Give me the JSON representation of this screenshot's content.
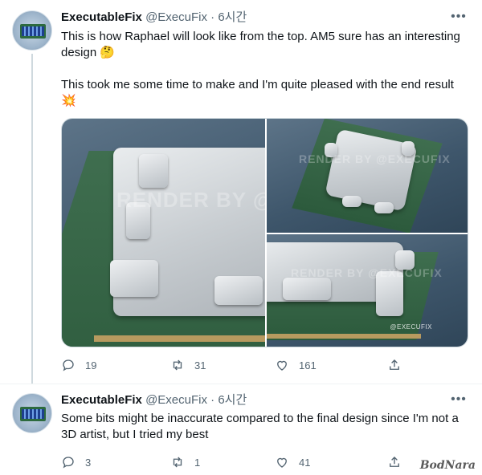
{
  "tweets": [
    {
      "author_name": "ExecutableFix",
      "author_handle": "@ExecuFix",
      "separator": "·",
      "time": "6시간",
      "text_paragraphs": [
        "This is how Raphael will look like from the top. AM5 sure has an interesting design 🤔",
        "This took me some time to make and I'm quite pleased with the end result 💥"
      ],
      "media": {
        "watermark_large": "RENDER BY @",
        "watermark_top_right": "RENDER BY @EXECUFIX",
        "watermark_bottom_right": "RENDER BY @EXECUFIX",
        "corner_credit": "@EXECUFIX"
      },
      "actions": {
        "reply_count": "19",
        "retweet_count": "31",
        "like_count": "161"
      }
    },
    {
      "author_name": "ExecutableFix",
      "author_handle": "@ExecuFix",
      "separator": "·",
      "time": "6시간",
      "text": "Some bits might be inaccurate compared to the final design since I'm not a 3D artist, but I tried my best",
      "actions": {
        "reply_count": "3",
        "retweet_count": "1",
        "like_count": "41"
      }
    }
  ],
  "site_watermark": "BodNara",
  "colors": {
    "text": "#0f1419",
    "secondary": "#536471",
    "border": "#cfd9de"
  },
  "icons": [
    "more-icon",
    "reply-icon",
    "retweet-icon",
    "like-icon",
    "share-icon"
  ]
}
